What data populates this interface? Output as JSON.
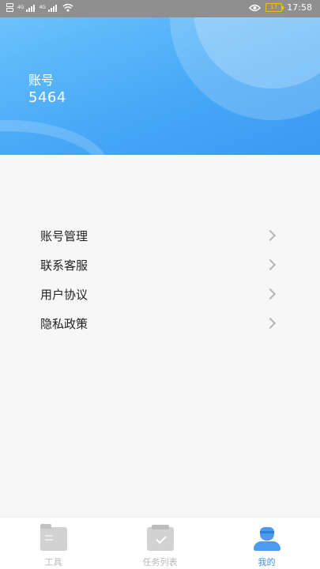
{
  "status_bar": {
    "network_label_1": "4G",
    "network_label_2": "4G",
    "battery_level": "17",
    "time": "17:58"
  },
  "header": {
    "account_label": "账号",
    "account_value": "5464"
  },
  "menu": {
    "items": [
      {
        "label": "账号管理"
      },
      {
        "label": "联系客服"
      },
      {
        "label": "用户协议"
      },
      {
        "label": "隐私政策"
      }
    ]
  },
  "tabbar": {
    "tabs": [
      {
        "label": "工具",
        "icon": "folder-icon",
        "active": false
      },
      {
        "label": "任务列表",
        "icon": "task-list-icon",
        "active": false
      },
      {
        "label": "我的",
        "icon": "profile-icon",
        "active": true
      }
    ]
  },
  "colors": {
    "header_gradient_start": "#6cc2fb",
    "header_gradient_end": "#3b99f2",
    "active_tab": "#3a8ff0",
    "inactive_tab": "#b9b9b9",
    "battery": "#f2c21b"
  }
}
